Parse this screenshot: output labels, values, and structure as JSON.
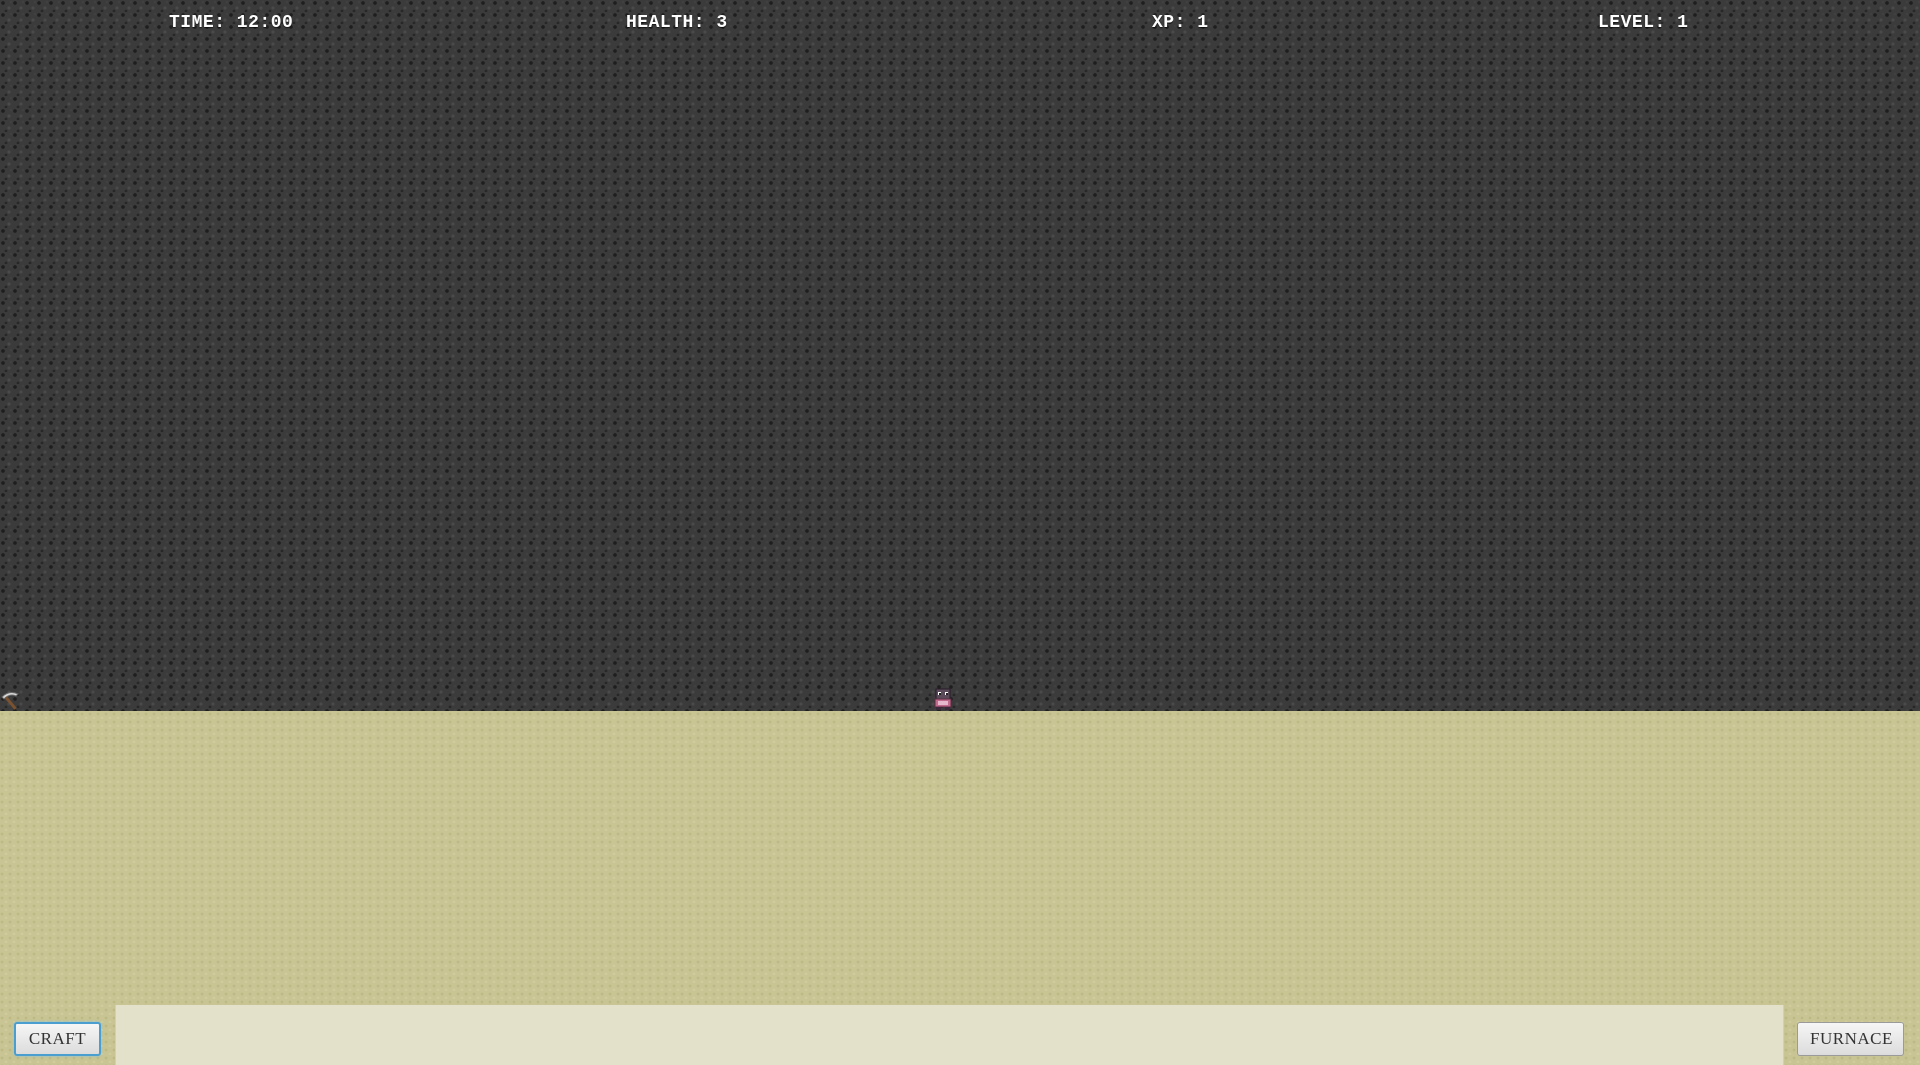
{
  "hud": {
    "time": "TIME: 12:00",
    "health": "HEALTH: 3",
    "xp": "XP: 1",
    "level": "LEVEL: 1"
  },
  "buttons": {
    "craft_label": "CRAFT",
    "furnace_label": "FURNACE"
  },
  "sprites": {
    "player_icon": "player-character-icon",
    "tool_icon": "pickaxe-icon"
  },
  "colors": {
    "sky": "#3b3b3b",
    "ground": "#c8c493",
    "inventory_bar": "#e4e1cb",
    "craft_focus_border": "#4a9fd0"
  }
}
